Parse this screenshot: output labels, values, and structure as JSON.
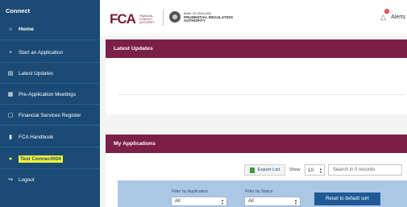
{
  "sidebar": {
    "title": "Connect",
    "items": [
      {
        "icon": "⌂",
        "label": "Home"
      },
      {
        "icon": "+",
        "label": "Start an Application"
      },
      {
        "icon": "▤",
        "label": "Latest Updates"
      },
      {
        "icon": "▦",
        "label": "Pre-Application Meetings"
      },
      {
        "icon": "▢",
        "label": "Financial Services Register"
      },
      {
        "icon": "▮",
        "label": "FCA Handbook"
      },
      {
        "icon": "●",
        "label": "Test Connect004"
      },
      {
        "icon": "↪",
        "label": "Logout"
      }
    ]
  },
  "header": {
    "fca_letters": "FCA",
    "fca_subtitle": "FINANCIAL CONDUCT AUTHORITY",
    "pra_line1": "BANK OF ENGLAND",
    "pra_line2": "PRUDENTIAL REGULATION",
    "pra_line3": "AUTHORITY",
    "alerts_label": "Alerts",
    "alerts_count": "0"
  },
  "latest_updates": {
    "title": "Latest Updates"
  },
  "my_applications": {
    "title": "My Applications",
    "export_label": "Export List",
    "show_label": "Show",
    "page_size": "10",
    "search_placeholder": "Search in 0 records",
    "filter_app_label": "Filter by Application",
    "filter_app_value": "All",
    "filter_status_label": "Filter by Status",
    "filter_status_value": "All",
    "reset_label": "Reset to default sort"
  },
  "colors": {
    "sidebar_bg": "#1b4a74",
    "panel_header": "#7c1f45",
    "filter_strip": "#aac8e6",
    "reset_button": "#1f5a96",
    "highlight": "#f5f53a"
  }
}
